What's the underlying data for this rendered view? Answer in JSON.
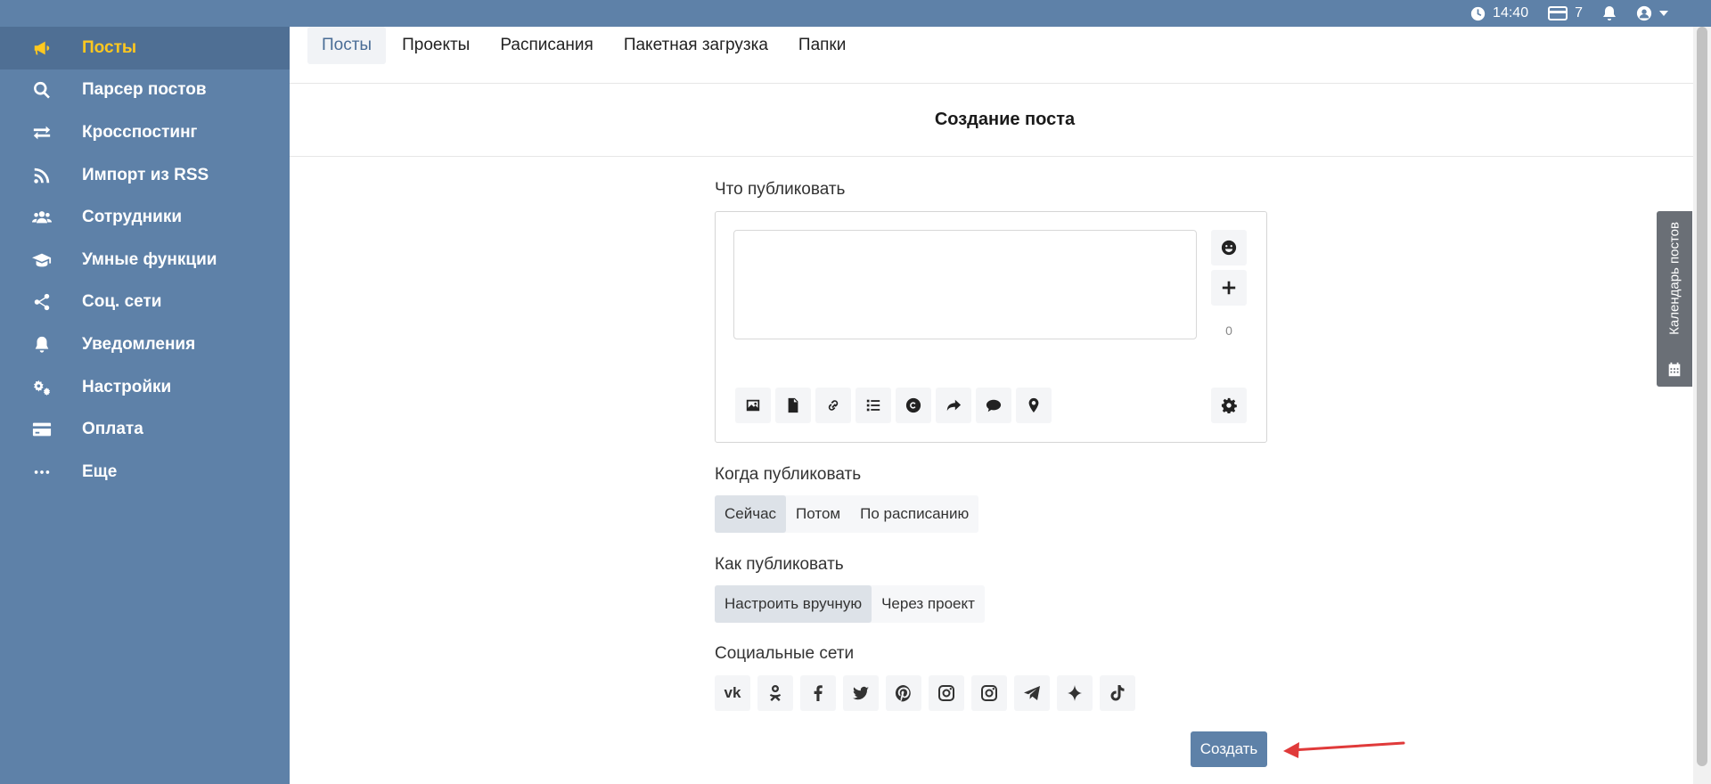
{
  "topbar": {
    "time": "14:40",
    "card_count": "7"
  },
  "sidebar": {
    "items": [
      {
        "label": "Посты",
        "icon": "megaphone-icon"
      },
      {
        "label": "Парсер постов",
        "icon": "search-icon"
      },
      {
        "label": "Кросспостинг",
        "icon": "exchange-icon"
      },
      {
        "label": "Импорт из RSS",
        "icon": "rss-icon"
      },
      {
        "label": "Сотрудники",
        "icon": "users-icon"
      },
      {
        "label": "Умные функции",
        "icon": "graduation-cap-icon"
      },
      {
        "label": "Соц. сети",
        "icon": "share-icon"
      },
      {
        "label": "Уведомления",
        "icon": "bell-icon"
      },
      {
        "label": "Настройки",
        "icon": "gears-icon"
      },
      {
        "label": "Оплата",
        "icon": "credit-card-icon"
      },
      {
        "label": "Еще",
        "icon": "ellipsis-icon"
      }
    ]
  },
  "tabs": [
    "Посты",
    "Проекты",
    "Расписания",
    "Пакетная загрузка",
    "Папки"
  ],
  "page_title": "Создание поста",
  "editor": {
    "label": "Что публиковать",
    "value": "",
    "char_count": "0"
  },
  "when": {
    "label": "Когда публиковать",
    "options": [
      "Сейчас",
      "Потом",
      "По расписанию"
    ],
    "selected": "Сейчас"
  },
  "how": {
    "label": "Как публиковать",
    "options": [
      "Настроить вручную",
      "Через проект"
    ],
    "selected": "Настроить вручную"
  },
  "socials": {
    "label": "Социальные сети",
    "networks": [
      "vk-icon",
      "odnoklassniki-icon",
      "facebook-icon",
      "twitter-icon",
      "pinterest-icon",
      "instagram-icon",
      "instagram-business-icon",
      "telegram-icon",
      "sparkle-icon",
      "tiktok-icon"
    ]
  },
  "create_button": "Создать",
  "calendar_tab": "Календарь постов",
  "colors": {
    "primary": "#5e81a8",
    "active_yellow": "#ffc81f",
    "arrow_red": "#e03a3a"
  }
}
